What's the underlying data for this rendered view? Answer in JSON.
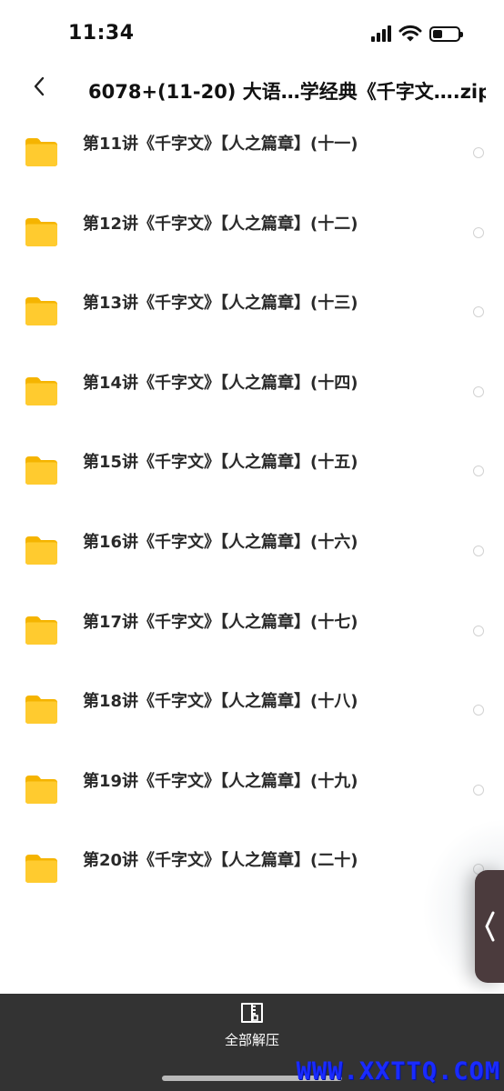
{
  "status_bar": {
    "time": "11:34",
    "icons": [
      "signal-icon",
      "wifi-icon",
      "battery-icon"
    ]
  },
  "nav": {
    "back_icon": "chevron-left-icon",
    "title": "6078+(11-20) 大语…学经典《千字文….zip"
  },
  "files": [
    {
      "name": "第11讲《千字文》【人之篇章】(十一)",
      "icon": "folder-icon"
    },
    {
      "name": "第12讲《千字文》【人之篇章】(十二)",
      "icon": "folder-icon"
    },
    {
      "name": "第13讲《千字文》【人之篇章】(十三)",
      "icon": "folder-icon"
    },
    {
      "name": "第14讲《千字文》【人之篇章】(十四)",
      "icon": "folder-icon"
    },
    {
      "name": "第15讲《千字文》【人之篇章】(十五)",
      "icon": "folder-icon"
    },
    {
      "name": "第16讲《千字文》【人之篇章】(十六)",
      "icon": "folder-icon"
    },
    {
      "name": "第17讲《千字文》【人之篇章】(十七)",
      "icon": "folder-icon"
    },
    {
      "name": "第18讲《千字文》【人之篇章】(十八)",
      "icon": "folder-icon"
    },
    {
      "name": "第19讲《千字文》【人之篇章】(十九)",
      "icon": "folder-icon"
    },
    {
      "name": "第20讲《千字文》【人之篇章】(二十)",
      "icon": "folder-icon"
    }
  ],
  "bottom_bar": {
    "extract_all_label": "全部解压",
    "extract_icon": "unzip-icon"
  },
  "watermark": "WWW.XXTTQ.COM",
  "colors": {
    "folder": "#FFCB2F",
    "bottom_bar": "#333333",
    "watermark": "#1A2BFF",
    "side_handle": "#4B3B3D"
  }
}
